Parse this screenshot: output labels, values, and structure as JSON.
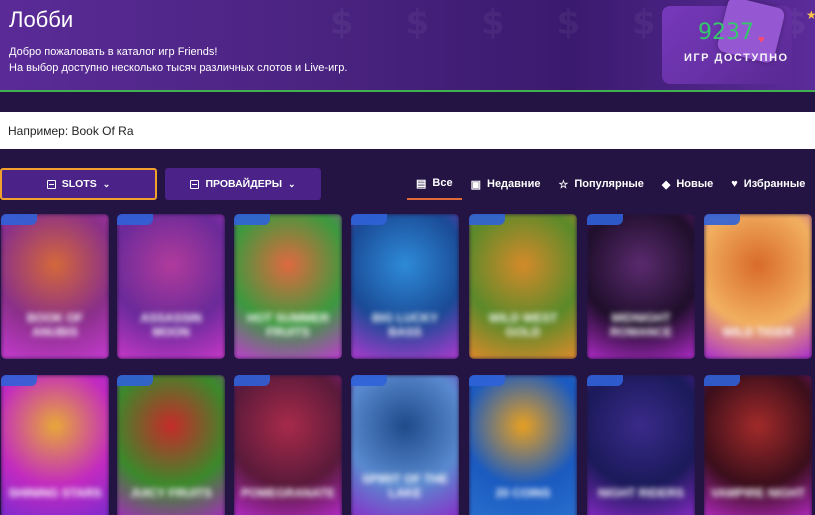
{
  "header": {
    "title": "Лобби",
    "subtitle_line1": "Добро пожаловать в каталог игр Friends!",
    "subtitle_line2": "На выбор доступно несколько тысяч различных слотов и Live-игр.",
    "decoration": "$ $ $ $ $ $ $ $ $ $ $ $ $ $ $ $ $ $",
    "counter": {
      "value": "9237",
      "label": "ИГР ДОСТУПНО"
    }
  },
  "search": {
    "placeholder": "Например: Book Of Ra"
  },
  "filters": {
    "slots_label": "SLOTS",
    "providers_label": "ПРОВАЙДЕРЫ"
  },
  "tabs": [
    {
      "label": "Все",
      "icon": "list-icon",
      "active": true
    },
    {
      "label": "Недавние",
      "icon": "history-icon",
      "active": false
    },
    {
      "label": "Популярные",
      "icon": "star-outline-icon",
      "active": false
    },
    {
      "label": "Новые",
      "icon": "diamond-icon",
      "active": false
    },
    {
      "label": "Избранные",
      "icon": "heart-icon",
      "active": false
    }
  ],
  "games": [
    {
      "title": "Book of Anubis",
      "palette": [
        "#d4683a",
        "#8a2f8a",
        "#c63bd0"
      ]
    },
    {
      "title": "Assassin Moon",
      "palette": [
        "#b13b9c",
        "#6a2a9a",
        "#c838c8"
      ]
    },
    {
      "title": "Hot Summer Fruits",
      "palette": [
        "#e0693f",
        "#3a9a3e",
        "#c23bd2"
      ]
    },
    {
      "title": "Big Lucky Bass",
      "palette": [
        "#2e8bd8",
        "#1a4a96",
        "#b03ad0"
      ]
    },
    {
      "title": "Wild West Gold",
      "palette": [
        "#d48a2a",
        "#5a8a2a",
        "#e08a2a"
      ]
    },
    {
      "title": "Midnight Romance",
      "palette": [
        "#5a2a6e",
        "#1e0e2a",
        "#b02ac8"
      ]
    },
    {
      "title": "Wild Tiger",
      "palette": [
        "#d86a2a",
        "#f2b060",
        "#a82ad0"
      ]
    },
    {
      "title": "Shining Stars",
      "palette": [
        "#e8a838",
        "#c22ac0",
        "#7a2ad0"
      ]
    },
    {
      "title": "Juicy Fruits",
      "palette": [
        "#c62a2a",
        "#3a8a2a",
        "#a82ac0"
      ]
    },
    {
      "title": "Pomegranate",
      "palette": [
        "#a82a4a",
        "#5a1a3a",
        "#b82ad0"
      ]
    },
    {
      "title": "Spirit of the Lake",
      "palette": [
        "#1e4a8a",
        "#5a8ad0",
        "#8a2ac8"
      ]
    },
    {
      "title": "20 Coins",
      "palette": [
        "#e8a020",
        "#1a5ac0",
        "#2a70d0"
      ]
    },
    {
      "title": "Night Riders",
      "palette": [
        "#3a2a8a",
        "#1a1a5a",
        "#8a2ac8"
      ]
    },
    {
      "title": "Vampire Night",
      "palette": [
        "#a22a2a",
        "#3a0e1a",
        "#b82ac8"
      ]
    }
  ]
}
